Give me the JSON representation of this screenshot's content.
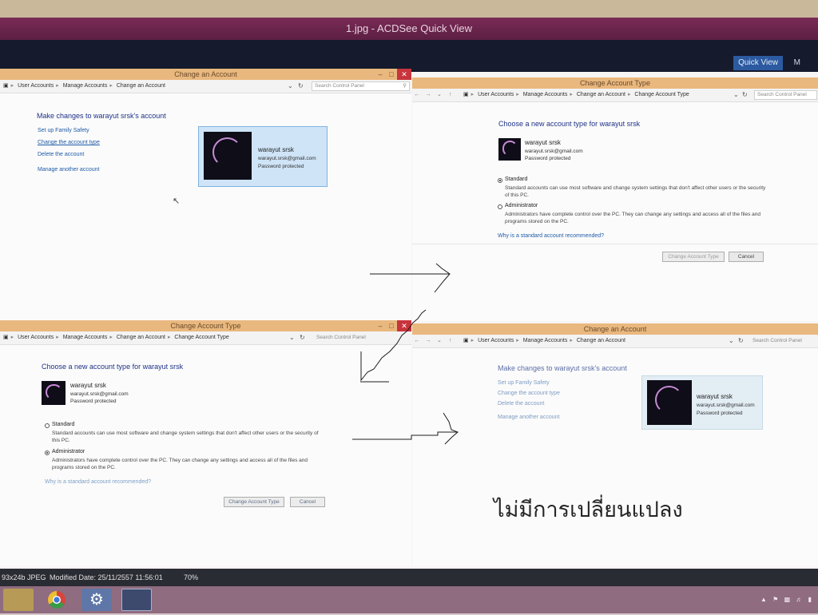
{
  "app": {
    "title": "1.jpg - ACDSee Quick View",
    "tabs": {
      "quick_view": "Quick View",
      "more": "M"
    }
  },
  "windows": {
    "top_left": {
      "title": "Change an Account",
      "crumbs": [
        "User Accounts",
        "Manage Accounts",
        "Change an Account"
      ],
      "search_placeholder": "Search Control Panel",
      "heading": "Make changes to warayut srsk's account",
      "links": [
        "Set up Family Safety",
        "Change the account type",
        "Delete the account",
        "Manage another account"
      ],
      "account": {
        "name": "warayut srsk",
        "email": "warayut.srsk@gmail.com",
        "status": "Password protected"
      }
    },
    "top_right": {
      "title": "Change Account Type",
      "crumbs": [
        "User Accounts",
        "Manage Accounts",
        "Change an Account",
        "Change Account Type"
      ],
      "search_placeholder": "Search Control Panel",
      "heading": "Choose a new account type for warayut srsk",
      "account": {
        "name": "warayut srsk",
        "email": "warayut.srsk@gmail.com",
        "status": "Password protected"
      },
      "options": [
        {
          "label": "Standard",
          "desc": "Standard accounts can use most software and change system settings that don't affect other users or the security of this PC.",
          "selected": true
        },
        {
          "label": "Administrator",
          "desc": "Administrators have complete control over the PC. They can change any settings and access all of the files and programs stored on the PC.",
          "selected": false
        }
      ],
      "why_link": "Why is a standard account recommended?",
      "change_button": "Change Account Type",
      "cancel_button": "Cancel"
    },
    "bottom_left": {
      "title": "Change Account Type",
      "crumbs": [
        "User Accounts",
        "Manage Accounts",
        "Change an Account",
        "Change Account Type"
      ],
      "search_placeholder": "Search Control Panel",
      "heading": "Choose a new account type for warayut srsk",
      "account": {
        "name": "warayut srsk",
        "email": "warayut.srsk@gmail.com",
        "status": "Password protected"
      },
      "options": [
        {
          "label": "Standard",
          "desc": "Standard accounts can use most software and change system settings that don't affect other users or the security of this PC.",
          "selected": false
        },
        {
          "label": "Administrator",
          "desc": "Administrators have complete control over the PC. They can change any settings and access all of the files and programs stored on the PC.",
          "selected": true
        }
      ],
      "why_link": "Why is a standard account recommended?",
      "change_button": "Change Account Type",
      "cancel_button": "Cancel"
    },
    "bottom_right": {
      "title": "Change an Account",
      "crumbs": [
        "User Accounts",
        "Manage Accounts",
        "Change an Account"
      ],
      "search_placeholder": "Search Control Panel",
      "heading": "Make changes to warayut srsk's account",
      "links": [
        "Set up Family Safety",
        "Change the account type",
        "Delete the account",
        "Manage another account"
      ],
      "account": {
        "name": "warayut srsk",
        "email": "warayut.srsk@gmail.com",
        "status": "Password protected"
      }
    }
  },
  "annotation": {
    "thai_note": "ไม่มีการเปลี่ยนแปลง"
  },
  "status_bar": {
    "file_info": "93x24b JPEG",
    "modified": "Modified Date: 25/11/2557 11:56:01",
    "zoom": "70%"
  },
  "taskbar": {
    "items": [
      "file-explorer-icon",
      "chrome-icon",
      "settings-gear-icon",
      "acdsee-icon"
    ]
  },
  "colors": {
    "title_bar": "#7a2b55",
    "window_title": "#e9b87e",
    "close_button": "#c8343c",
    "link": "#1e5ba8",
    "heading": "#1e3287",
    "selected_card": "#cfe4f7"
  }
}
